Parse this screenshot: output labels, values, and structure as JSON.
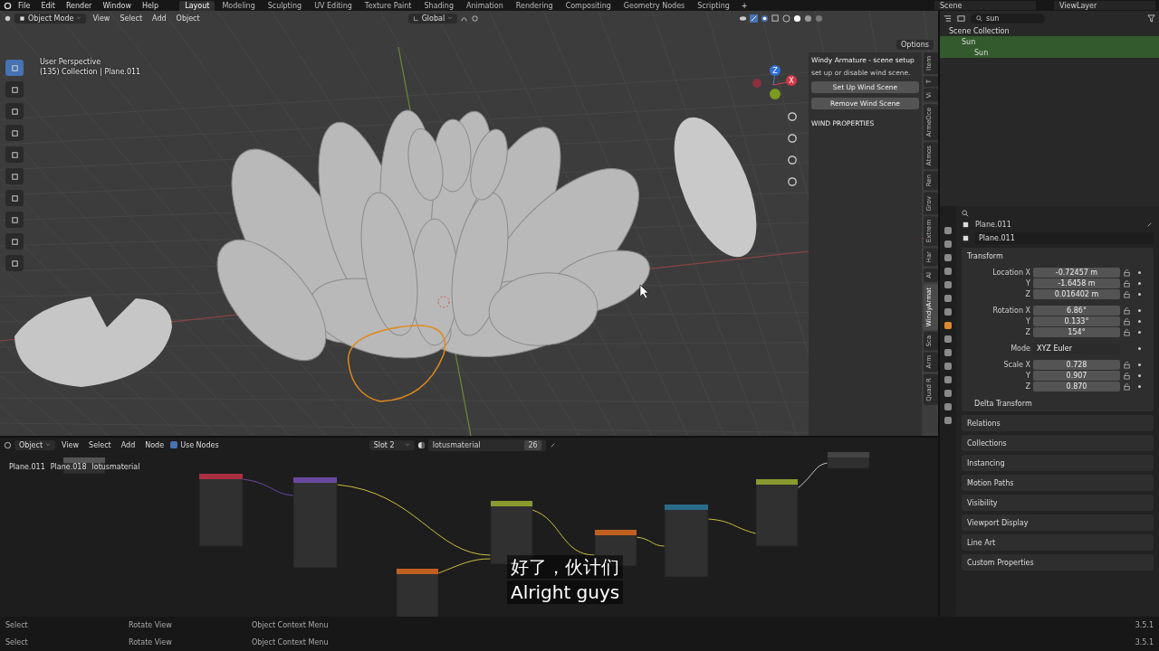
{
  "menubar": {
    "menus": [
      "File",
      "Edit",
      "Render",
      "Window",
      "Help"
    ],
    "workspaces": [
      {
        "label": "Layout",
        "selected": true
      },
      {
        "label": "Modeling",
        "selected": false
      },
      {
        "label": "Sculpting",
        "selected": false
      },
      {
        "label": "UV Editing",
        "selected": false
      },
      {
        "label": "Texture Paint",
        "selected": false
      },
      {
        "label": "Shading",
        "selected": false
      },
      {
        "label": "Animation",
        "selected": false
      },
      {
        "label": "Rendering",
        "selected": false
      },
      {
        "label": "Compositing",
        "selected": false
      },
      {
        "label": "Geometry Nodes",
        "selected": false
      },
      {
        "label": "Scripting",
        "selected": false
      }
    ],
    "add_tab": "+",
    "scene": "Scene",
    "view_layer": "ViewLayer"
  },
  "viewport": {
    "mode": "Object Mode",
    "menus": [
      "View",
      "Select",
      "Add",
      "Object"
    ],
    "orientation": "Global",
    "options": "Options",
    "overlay_text": [
      "User Perspective",
      "(135) Collection | Plane.011"
    ],
    "gizmo_labels": [
      "Z",
      "X"
    ],
    "sidebar": {
      "panel_title": "Windy Armature - scene setup",
      "description": "set up or disable wind scene.",
      "buttons": [
        "Set Up Wind Scene",
        "Remove Wind Scene"
      ],
      "section": "WIND PROPERTIES"
    },
    "tabs": [
      {
        "label": "Item",
        "selected": false
      },
      {
        "label": "T",
        "selected": false
      },
      {
        "label": "Vi",
        "selected": false
      },
      {
        "label": "ArmeOce",
        "selected": false
      },
      {
        "label": "Atmos",
        "selected": false
      },
      {
        "label": "Ren",
        "selected": false
      },
      {
        "label": "Grov",
        "selected": false
      },
      {
        "label": "Extrem",
        "selected": false
      },
      {
        "label": "Har",
        "selected": false
      },
      {
        "label": "Al",
        "selected": false
      },
      {
        "label": "WindyArmat",
        "selected": true
      },
      {
        "label": "Sca",
        "selected": false
      },
      {
        "label": "Arm",
        "selected": false
      },
      {
        "label": "Quad R",
        "selected": false
      }
    ]
  },
  "outliner": {
    "search": "sun",
    "items": [
      {
        "label": "Scene Collection",
        "selected": false,
        "children": [
          {
            "label": "Sun",
            "selected": true,
            "children": [
              {
                "label": "Sun",
                "selected": true
              }
            ]
          }
        ]
      }
    ]
  },
  "properties": {
    "object": "Plane.011",
    "data_name": "Plane.011",
    "section": "Transform",
    "transform": [
      {
        "rows": [
          {
            "kind": "number",
            "label": "Location X",
            "value": "-0.72457 m"
          },
          {
            "kind": "number",
            "label": "Y",
            "value": "-1.6458 m"
          },
          {
            "kind": "number",
            "label": "Z",
            "value": "0.016402 m"
          }
        ]
      },
      {
        "rows": [
          {
            "kind": "number",
            "label": "Rotation X",
            "value": "6.86°"
          },
          {
            "kind": "number",
            "label": "Y",
            "value": "0.133°"
          },
          {
            "kind": "number",
            "label": "Z",
            "value": "154°"
          }
        ]
      },
      {
        "rows": [
          {
            "kind": "dropdown",
            "label": "Mode",
            "value": "XYZ Euler"
          }
        ]
      },
      {
        "rows": [
          {
            "kind": "number",
            "label": "Scale X",
            "value": "0.728"
          },
          {
            "kind": "number",
            "label": "Y",
            "value": "0.907"
          },
          {
            "kind": "number",
            "label": "Z",
            "value": "0.870"
          }
        ]
      }
    ],
    "subsection": "Delta Transform",
    "panels": [
      "Relations",
      "Collections",
      "Instancing",
      "Motion Paths",
      "Visibility",
      "Viewport Display",
      "Line Art",
      "Custom Properties"
    ]
  },
  "node_editor": {
    "mode": "Object",
    "menus": [
      "View",
      "Select",
      "Add",
      "Node"
    ],
    "use_nodes": {
      "label": "Use Nodes",
      "checked": true
    },
    "slot": "Slot 2",
    "material": "lotusmaterial",
    "users": "26",
    "breadcrumbs": [
      "Plane.011",
      "Plane.018",
      "lotusmaterial"
    ]
  },
  "subtitles": [
    "好了，伙计们",
    "Alright guys"
  ],
  "status_bars": [
    {
      "items": [
        "Select",
        "Rotate View",
        "Object Context Menu"
      ],
      "version": "3.5.1"
    },
    {
      "items": [
        "Select",
        "Rotate View",
        "Object Context Menu"
      ],
      "version": "3.5.1"
    }
  ]
}
